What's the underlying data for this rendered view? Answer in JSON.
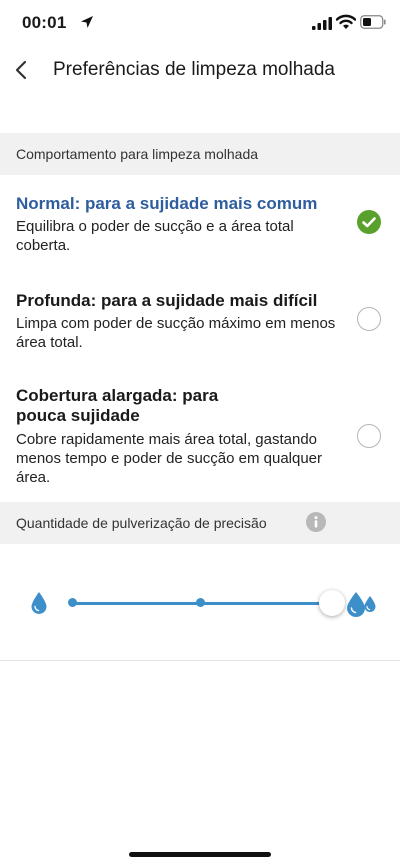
{
  "status_bar": {
    "time": "00:01"
  },
  "header": {
    "title": "Preferências de limpeza molhada"
  },
  "behavior_section": {
    "label": "Comportamento para limpeza molhada"
  },
  "options": [
    {
      "title": "Normal: para a sujidade mais comum",
      "description": "Equilibra o poder de sucção e a área total coberta.",
      "selected": true
    },
    {
      "title": "Profunda: para a sujidade mais difícil",
      "description": "Limpa com poder de sucção máximo em menos área total.",
      "selected": false
    },
    {
      "title": "Cobertura alargada: para pouca sujidade",
      "description": "Cobre rapidamente mais área total, gastando menos tempo e poder de sucção em qualquer área.",
      "selected": false
    }
  ],
  "spray_section": {
    "label": "Quantidade de pulverização de precisão"
  },
  "spray_slider": {
    "levels": 3,
    "selected_level": 3
  },
  "colors": {
    "accent_blue": "#3d8fca",
    "selected_title": "#2f5e9e",
    "check_green": "#5aa02c"
  }
}
